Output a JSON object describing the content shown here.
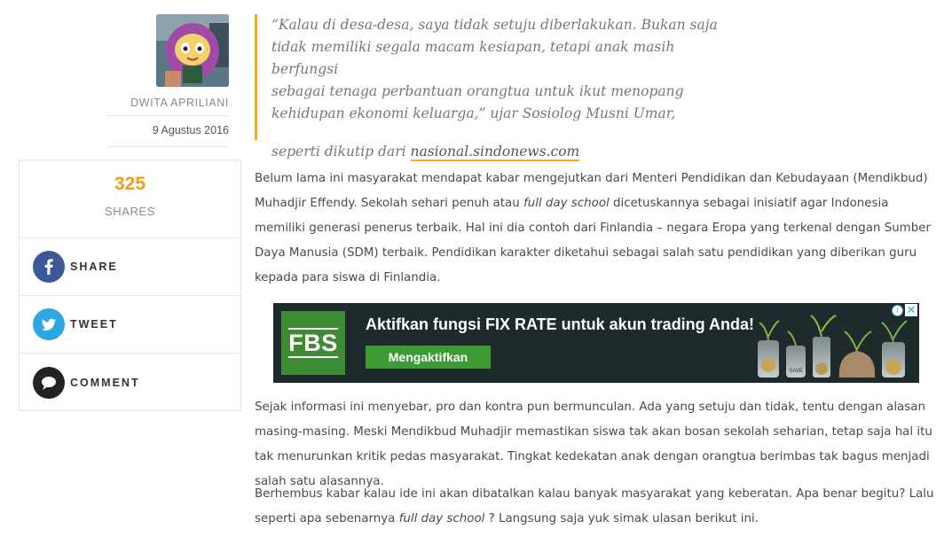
{
  "author": {
    "name": "DWITA APRILIANI",
    "date": "9 Agustus 2016"
  },
  "shares": {
    "count": "325",
    "label": "SHARES",
    "facebook_label": "SHARE",
    "twitter_label": "TWEET",
    "comment_label": "COMMENT"
  },
  "quote": {
    "line1": "“Kalau di desa-desa, saya tidak setuju diberlakukan. Bukan saja",
    "line2": "tidak memiliki segala macam kesiapan, tetapi anak masih berfungsi",
    "line3": "sebagai tenaga perbantuan orangtua untuk ikut menopang",
    "line4": "kehidupan ekonomi keluarga,” ujar Sosiolog Musni Umar,",
    "source_prefix": "seperti dikutip dari ",
    "source_link": "nasional.sindonews.com"
  },
  "article": {
    "p1_a": "Belum lama ini masyarakat mendapat kabar mengejutkan dari Menteri Pendidikan dan Kebudayaan (Mendikbud) Muhadjir Effendy. Sekolah sehari penuh atau ",
    "p1_em": "full day school",
    "p1_b": " dicetuskannya sebagai inisiatif agar Indonesia memiliki generasi penerus terbaik. Hal ini dia contoh dari Finlandia – negara Eropa yang terkenal dengan Sumber Daya Manusia (SDM) terbaik. Pendidikan karakter diketahui sebagai salah satu pendidikan yang diberikan guru kepada para siswa di Finlandia.",
    "p2": "Sejak informasi ini menyebar, pro dan kontra pun bermunculan. Ada yang setuju dan tidak, tentu dengan alasan masing-masing. Meski Mendikbud Muhadjir memastikan siswa tak akan bosan sekolah seharian, tetap saja hal itu tak menurunkan kritik pedas masyarakat. Tingkat kedekatan anak dengan orangtua berimbas tak bagus menjadi salah satu alasannya.",
    "p3_a": "Berhembus kabar kalau ide ini akan dibatalkan kalau banyak masyarakat yang keberatan. Apa benar begitu? Lalu seperti apa sebenarnya ",
    "p3_em": "full day school",
    "p3_b": " ? Langsung saja yuk simak ulasan berikut ini."
  },
  "ad": {
    "logo": "FBS",
    "headline": "Aktifkan fungsi FIX RATE untuk akun trading Anda!",
    "button": "Mengaktifkan",
    "info_glyph": "i",
    "close_glyph": "✕",
    "jar_label": "SAVE"
  },
  "colors": {
    "accent": "#f39c1b",
    "facebook": "#3b5998",
    "twitter": "#2da6e3",
    "comment": "#222222",
    "ad_green": "#3d9b35"
  }
}
